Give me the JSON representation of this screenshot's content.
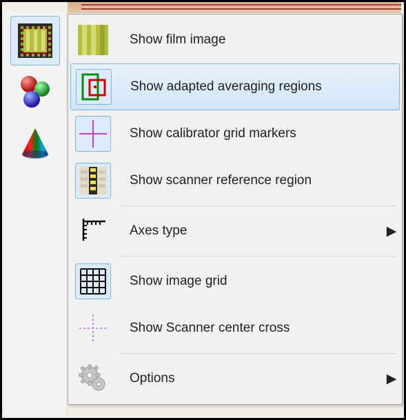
{
  "sidebar": {
    "tools": [
      {
        "name": "film-image-tool",
        "selected": true
      },
      {
        "name": "rgb-spheres-tool",
        "selected": false
      },
      {
        "name": "cone-tool",
        "selected": false
      }
    ]
  },
  "menu": {
    "items": [
      {
        "id": "show-film-image",
        "label": "Show film image",
        "icon": "film-image-icon",
        "active": false,
        "hover": false,
        "submenu": false
      },
      {
        "id": "show-adapted-regions",
        "label": "Show adapted averaging regions",
        "icon": "adapted-regions-icon",
        "active": true,
        "hover": true,
        "submenu": false
      },
      {
        "id": "show-calibrator-grid",
        "label": "Show calibrator grid markers",
        "icon": "calibrator-grid-icon",
        "active": true,
        "hover": false,
        "submenu": false
      },
      {
        "id": "show-scanner-ref",
        "label": "Show scanner reference region",
        "icon": "scanner-ref-icon",
        "active": true,
        "hover": false,
        "submenu": false
      },
      {
        "sep": true
      },
      {
        "id": "axes-type",
        "label": "Axes type",
        "icon": "axes-type-icon",
        "active": false,
        "hover": false,
        "submenu": true
      },
      {
        "sep": true
      },
      {
        "id": "show-image-grid",
        "label": "Show image grid",
        "icon": "image-grid-icon",
        "active": true,
        "hover": false,
        "submenu": false
      },
      {
        "id": "show-scanner-center",
        "label": "Show Scanner center cross",
        "icon": "scanner-center-icon",
        "active": false,
        "hover": false,
        "submenu": false
      },
      {
        "sep": true
      },
      {
        "id": "options",
        "label": "Options",
        "icon": "gear-icon",
        "active": false,
        "hover": false,
        "submenu": true
      }
    ],
    "submenu_arrow": "▶"
  }
}
